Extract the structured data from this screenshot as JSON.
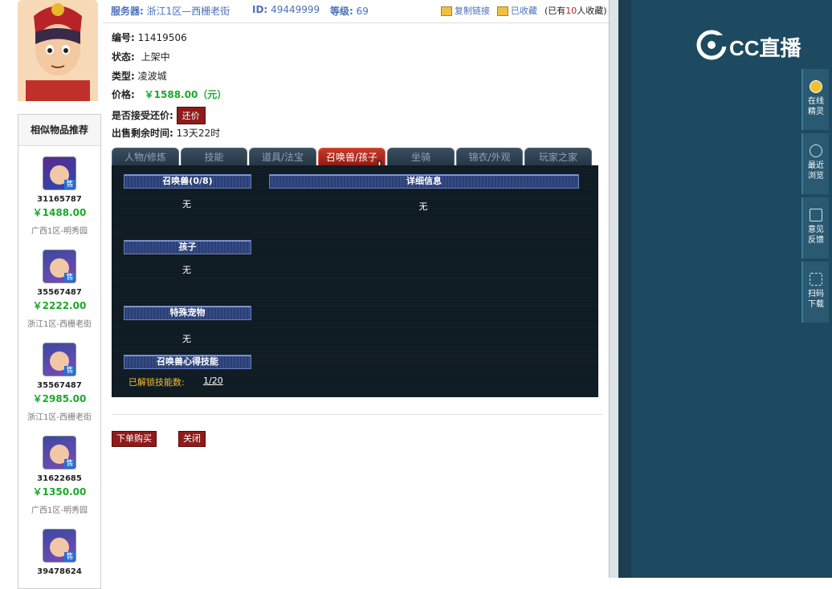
{
  "header": {
    "server_label": "服务器:",
    "server_value": "浙江1区—西栅老街",
    "id_label": "ID:",
    "id_value": "49449999",
    "level_label": "等级:",
    "level_value": "69",
    "copy_link": "复制链接",
    "collected": "已收藏",
    "collect_count_prefix": "(已有",
    "collect_count": "10",
    "collect_count_suffix": "人收藏)"
  },
  "info": {
    "number_label": "编号:",
    "number_value": "11419506",
    "status_label": "状态:",
    "status_value": "上架中",
    "type_label": "类型:",
    "type_value": "凌波城",
    "price_label": "价格:",
    "price_value": "￥1588.00（元）",
    "bargain_label": "是否接受还价:",
    "bargain_button": "还价",
    "time_label": "出售剩余时间:",
    "time_value": "13天22时"
  },
  "tabs": [
    {
      "label": "人物/修炼"
    },
    {
      "label": "技能"
    },
    {
      "label": "道具/法宝"
    },
    {
      "label": "召唤兽/孩子"
    },
    {
      "label": "坐骑"
    },
    {
      "label": "锦衣/外观"
    },
    {
      "label": "玩家之家"
    }
  ],
  "panel": {
    "summon_header": "召唤兽(0/8)",
    "summon_value": "无",
    "detail_header": "详细信息",
    "detail_value": "无",
    "child_header": "孩子",
    "child_value": "无",
    "special_header": "特殊宠物",
    "special_value": "无",
    "skill_header": "召唤兽心得技能",
    "unlock_label": "已解锁技能数:",
    "unlock_value": "1/20"
  },
  "buttons": {
    "order": "下单购买",
    "close": "关闭"
  },
  "similar": {
    "title": "相似物品推荐",
    "items": [
      {
        "id": "31165787",
        "price": "￥1488.00",
        "server": "广西1区-明秀园"
      },
      {
        "id": "35567487",
        "price": "￥2222.00",
        "server": "浙江1区-西栅老街"
      },
      {
        "id": "35567487",
        "price": "￥2985.00",
        "server": "浙江1区-西栅老街"
      },
      {
        "id": "31622685",
        "price": "￥1350.00",
        "server": "广西1区-明秀园"
      },
      {
        "id": "39478624",
        "price": "",
        "server": ""
      }
    ],
    "badge": "售"
  },
  "right_panel": {
    "logo_text": "CC直播",
    "tools": [
      {
        "line1": "在线",
        "line2": "精灵",
        "icon": "sprite-icon"
      },
      {
        "line1": "最近",
        "line2": "浏览",
        "icon": "clock-icon"
      },
      {
        "line1": "意见",
        "line2": "反馈",
        "icon": "edit-icon"
      },
      {
        "line1": "扫码",
        "line2": "下载",
        "icon": "scan-icon"
      }
    ]
  },
  "colors": {
    "accent_blue": "#4a70b8",
    "price_green": "#1aaa2a",
    "button_red": "#8f1a1a",
    "panel_bg": "#0e1a22",
    "right_bg": "#1d4a60"
  }
}
